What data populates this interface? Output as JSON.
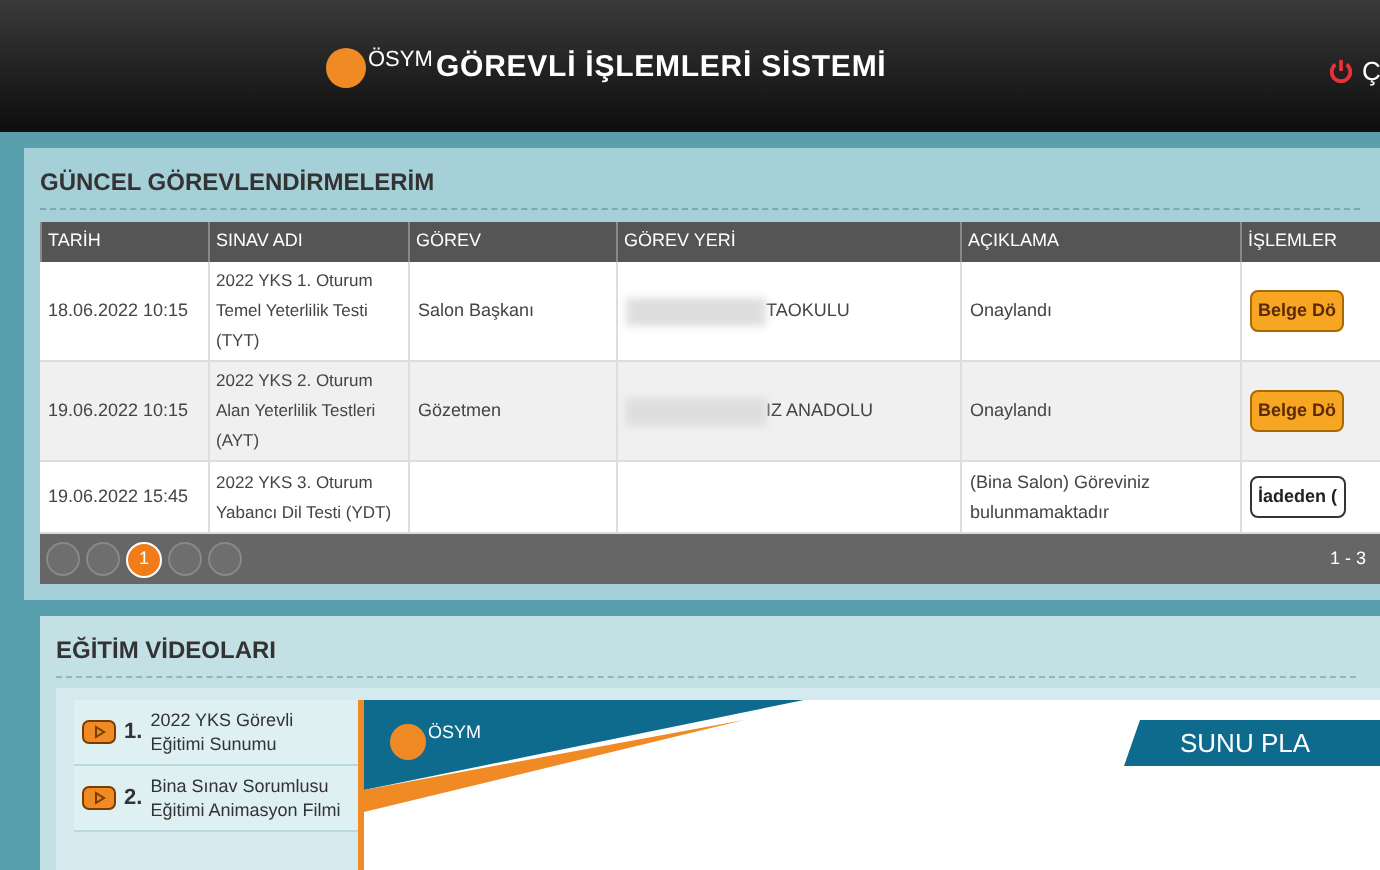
{
  "header": {
    "logo": "ÖSYM",
    "title": "GÖREVLİ İŞLEMLERİ SİSTEMİ",
    "logout": "Ç"
  },
  "assignments": {
    "title": "GÜNCEL GÖREVLENDİRMELERİM",
    "columns": [
      "TARİH",
      "SINAV ADI",
      "GÖREV",
      "GÖREV YERİ",
      "AÇIKLAMA",
      "İŞLEMLER"
    ],
    "rows": [
      {
        "date": "18.06.2022 10:15",
        "exam": "2022 YKS 1. Oturum Temel Yeterlilik Testi (TYT)",
        "role": "Salon Başkanı",
        "place": "TAOKULU",
        "note": "Onaylandı",
        "action": {
          "label": "Belge Dö",
          "kind": "primary"
        }
      },
      {
        "date": "19.06.2022 10:15",
        "exam": "2022 YKS 2. Oturum Alan Yeterlilik Testleri (AYT)",
        "role": "Gözetmen",
        "place": "IZ ANADOLU",
        "note": "Onaylandı",
        "action": {
          "label": "Belge Dö",
          "kind": "primary"
        }
      },
      {
        "date": "19.06.2022 15:45",
        "exam": "2022 YKS 3. Oturum Yabancı Dil Testi (YDT)",
        "role": "",
        "place": "",
        "note": "(Bina Salon) Göreviniz bulunmamaktadır",
        "action": {
          "label": "İadeden (",
          "kind": "outline"
        }
      }
    ],
    "pager": {
      "pages": [
        {
          "label": "1",
          "selected": true
        }
      ],
      "range": "1 - 3"
    }
  },
  "videos": {
    "title": "EĞİTİM VİDEOLARI",
    "items": [
      {
        "number": "1.",
        "label": "2022 YKS Görevli Eğitimi Sunumu"
      },
      {
        "number": "2.",
        "label": "Bina Sınav Sorumlusu Eğitimi Animasyon Filmi"
      }
    ],
    "preview": {
      "logo": "ÖSYM",
      "banner": "SUNU PLA"
    }
  }
}
